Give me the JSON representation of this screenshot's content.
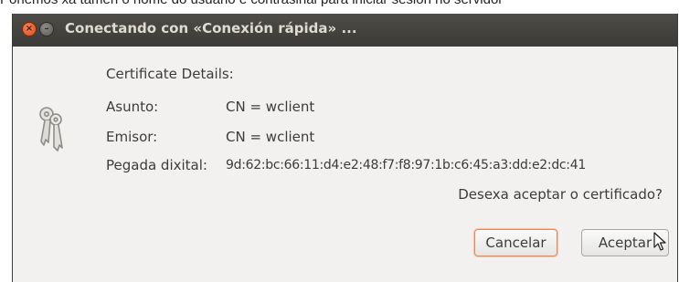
{
  "background_text": "Ponemos xa tamén o nome do usuario e contrasinal para iniciar sesión no servidor",
  "window": {
    "title": "Conectando con «Conexión rápida» ...",
    "close_glyph": "×",
    "minimize_glyph": "–"
  },
  "dialog": {
    "heading": "Certificate Details:",
    "fields": [
      {
        "label": "Asunto:",
        "value": "CN = wclient"
      },
      {
        "label": "Emisor:",
        "value": "CN = wclient"
      },
      {
        "label": "Pegada dixital:",
        "value": "9d:62:bc:66:11:d4:e2:48:f7:f8:97:1b:c6:45:a3:dd:e2:dc:41"
      }
    ],
    "question": "Desexa aceptar o certificado?",
    "cancel_label": "Cancelar",
    "accept_label": "Aceptar"
  },
  "icons": {
    "dialog_icon": "keys-icon",
    "close": "close-icon",
    "minimize": "minimize-icon",
    "cursor": "mouse-pointer-icon"
  },
  "colors": {
    "titlebar": "#3c3b37",
    "close_button": "#df4a16",
    "dialog_bg": "#f2f1f0",
    "cancel_focus_border": "#e5885a"
  }
}
